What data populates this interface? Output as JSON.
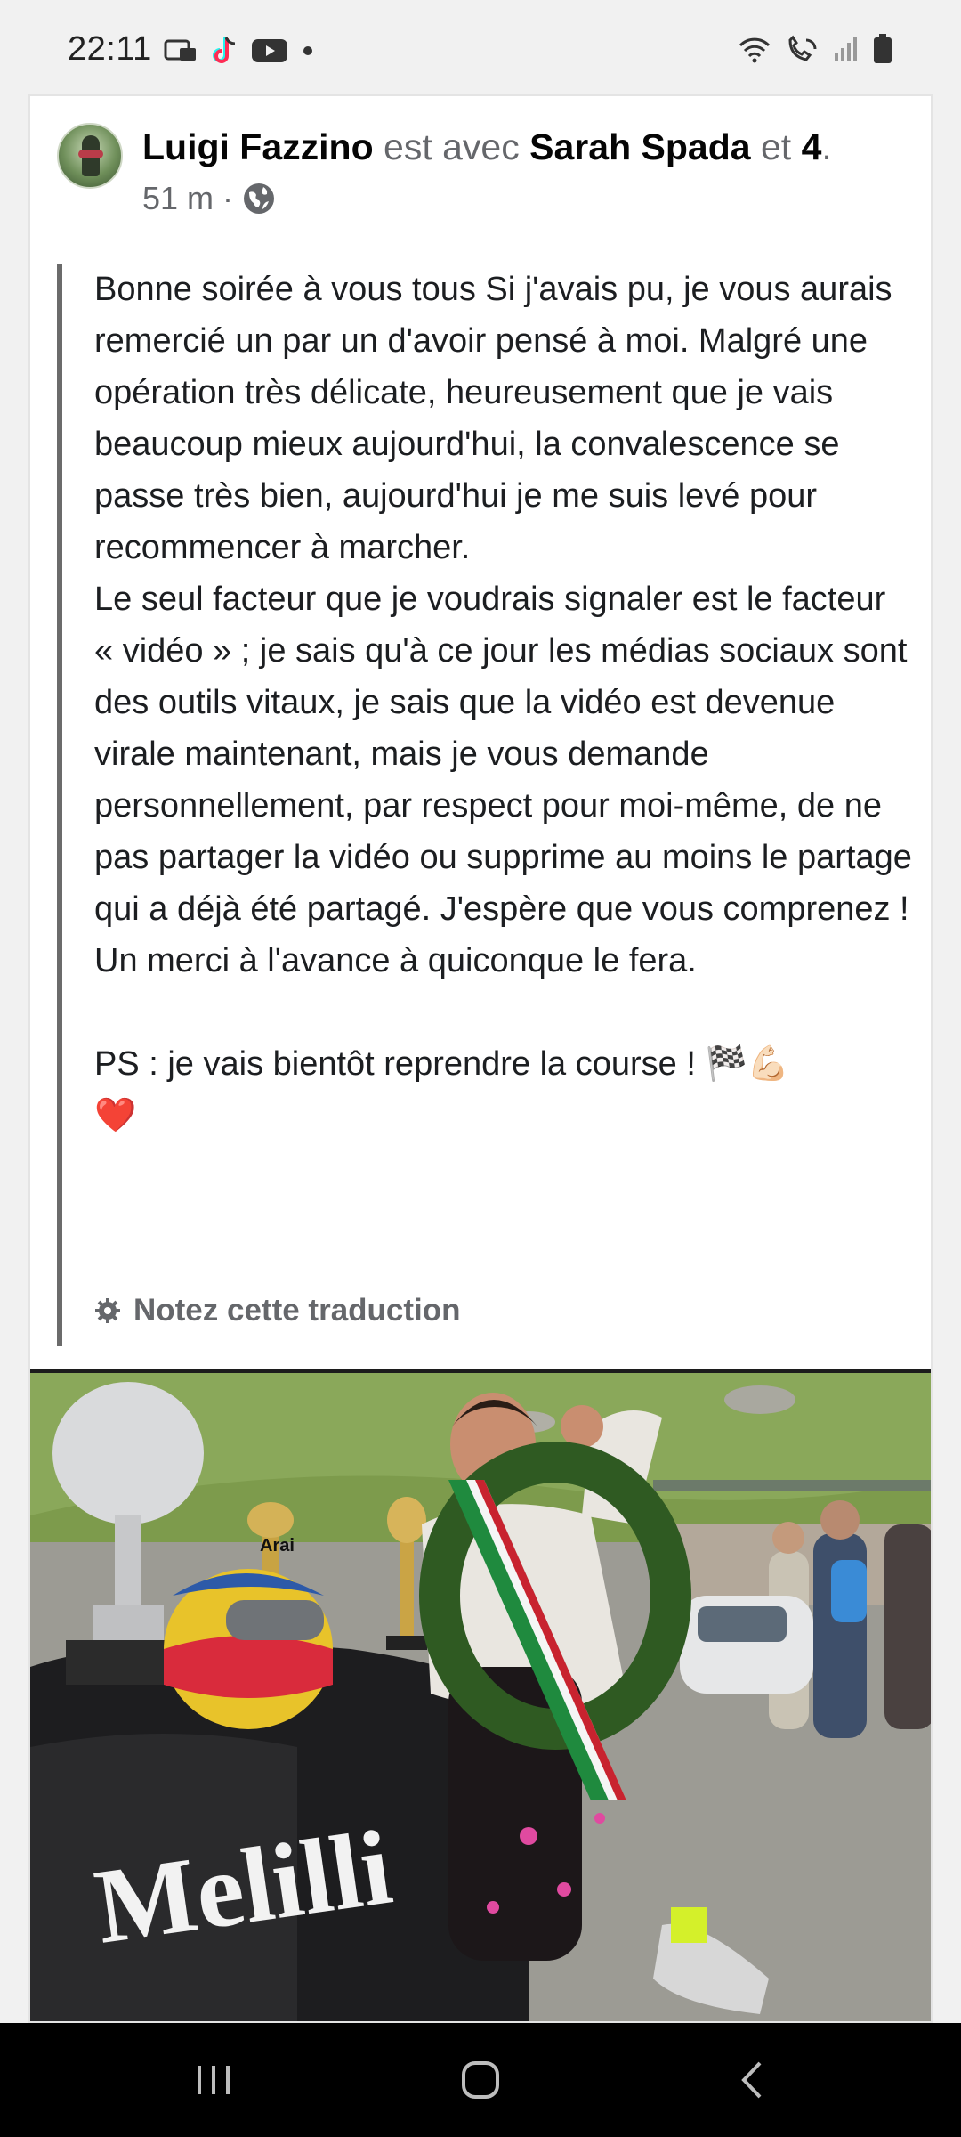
{
  "status_bar": {
    "time": "22:11",
    "left_icons": [
      "vpn-icon",
      "tiktok-icon",
      "youtube-icon",
      "dot-icon"
    ],
    "right_icons": [
      "wifi-icon",
      "wifi-call-icon",
      "signal-icon",
      "battery-icon"
    ]
  },
  "post": {
    "author": "Luigi Fazzino",
    "with_text": "est avec",
    "tagged_person": "Sarah Spada",
    "and_text": "et",
    "others_count": "4",
    "period": ".",
    "timestamp": "51 m",
    "separator": "·",
    "privacy_icon": "globe-icon",
    "text": "Bonne soirée à vous tous Si j'avais pu, je vous aurais remercié un par un d'avoir pensé à moi. Malgré une opération très délicate, heureusement que je vais beaucoup mieux aujourd'hui, la convalescence se passe très bien, aujourd'hui je me suis levé pour recommencer à marcher.\nLe seul facteur que je voudrais signaler est le facteur « vidéo » ; je sais qu'à ce jour les médias sociaux sont des outils vitaux, je sais que la vidéo est devenue virale maintenant, mais je vous demande personnellement, par respect pour moi-même, de ne pas partager la vidéo ou supprime au moins le partage qui a déjà été partagé. J'espère que vous comprenez ! Un merci à l'avance à quiconque le fera.\n\nPS : je vais bientôt reprendre la course ! 🏁💪🏻\n❤️",
    "rate_translation": "Notez cette traduction",
    "photo_text": {
      "car_brand": "Melilli",
      "helmet_brand": "Arai"
    }
  },
  "colors": {
    "muted_text": "#65676b",
    "text": "#050505",
    "quote_bar": "#6b6b6b",
    "navbar": "#000000"
  },
  "nav": {
    "recents": "recents-icon",
    "home": "home-icon",
    "back": "back-icon"
  }
}
